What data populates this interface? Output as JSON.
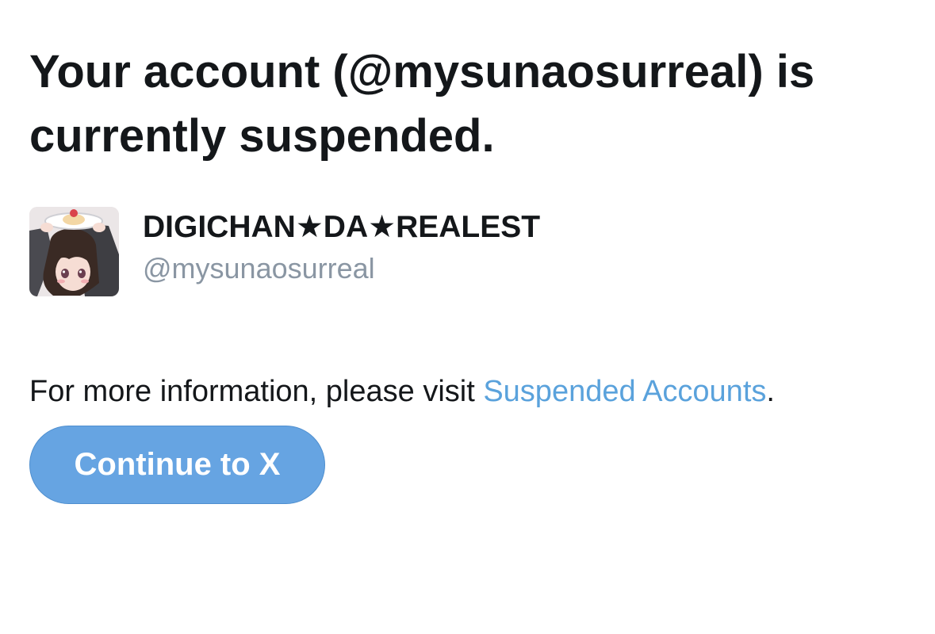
{
  "notice": {
    "headline": "Your account (@mysunaosurreal) is currently suspended."
  },
  "profile": {
    "display_name": "DIGICHAN★DA★REALEST",
    "handle": "@mysunaosurreal",
    "avatar_icon": "profile-photo"
  },
  "info": {
    "prefix": "For more information, please visit ",
    "link_text": "Suspended Accounts",
    "suffix": "."
  },
  "actions": {
    "continue_label": "Continue to X"
  },
  "colors": {
    "text": "#14171a",
    "secondary_text": "#8a96a3",
    "link": "#5aa2dc",
    "button_bg": "#66a4e2",
    "button_text": "#ffffff"
  }
}
